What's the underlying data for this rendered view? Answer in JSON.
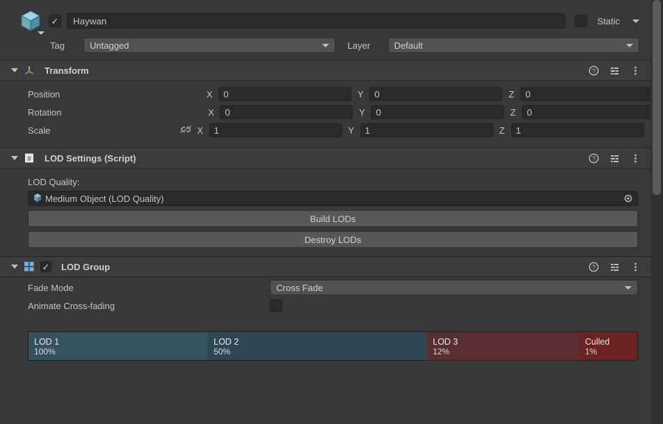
{
  "header": {
    "active": true,
    "name": "Haywan",
    "static_label": "Static",
    "tag_label": "Tag",
    "tag_value": "Untagged",
    "layer_label": "Layer",
    "layer_value": "Default"
  },
  "transform": {
    "title": "Transform",
    "position_label": "Position",
    "rotation_label": "Rotation",
    "scale_label": "Scale",
    "axis_x": "X",
    "axis_y": "Y",
    "axis_z": "Z",
    "position": {
      "x": "0",
      "y": "0",
      "z": "0"
    },
    "rotation": {
      "x": "0",
      "y": "0",
      "z": "0"
    },
    "scale": {
      "x": "1",
      "y": "1",
      "z": "1"
    }
  },
  "lod_settings": {
    "title": "LOD Settings (Script)",
    "quality_label": "LOD Quality:",
    "quality_value": "Medium Object (LOD Quality)",
    "build_btn": "Build LODs",
    "destroy_btn": "Destroy LODs"
  },
  "lod_group": {
    "title": "LOD Group",
    "enabled": true,
    "fade_mode_label": "Fade Mode",
    "fade_mode_value": "Cross Fade",
    "animate_label": "Animate Cross-fading",
    "segments": [
      {
        "name": "LOD 1",
        "pct": "100%"
      },
      {
        "name": "LOD 2",
        "pct": "50%"
      },
      {
        "name": "LOD 3",
        "pct": "12%"
      },
      {
        "name": "Culled",
        "pct": "1%"
      }
    ]
  },
  "colors": {
    "lod1": "#35525c",
    "lod2": "#2e4853",
    "lod3": "#5a2e2e",
    "culled": "#6d2222"
  }
}
